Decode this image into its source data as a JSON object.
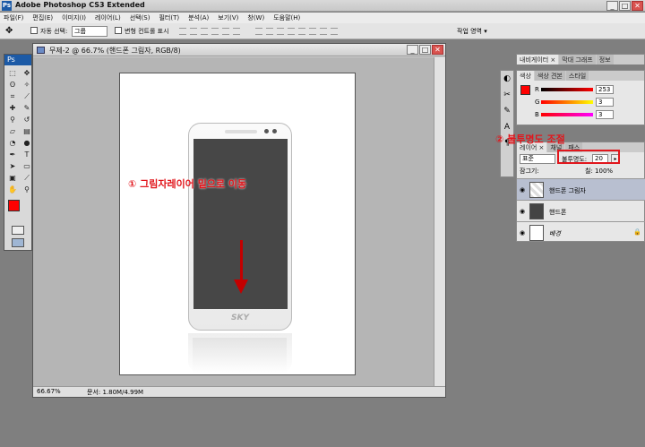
{
  "app": {
    "title": "Adobe Photoshop CS3 Extended",
    "icon_label": "Ps",
    "winbtns": [
      "_",
      "□",
      "✕"
    ]
  },
  "menu": [
    "파일(F)",
    "편집(E)",
    "이미지(I)",
    "레이어(L)",
    "선택(S)",
    "필터(T)",
    "분석(A)",
    "보기(V)",
    "창(W)",
    "도움말(H)"
  ],
  "options": {
    "auto_select_label": "자동 선택:",
    "auto_select_value": "그룹",
    "transform_label": "변형 컨트롤 표시",
    "workspace_label": "작업 영역 ▾"
  },
  "toolbox": {
    "logo": "Ps"
  },
  "document": {
    "title": "무제-2 @ 66.7% (핸드폰 그림자, RGB/8)",
    "zoom": "66.67%",
    "doc_info": "문서: 1.80M/4.99M",
    "phone_brand": "SKY"
  },
  "annotations": {
    "step1": "① 그림자레이어 밑으로 이동",
    "step2": "② 불투명도 조절"
  },
  "panels": {
    "nav_tabs": [
      "내비게이터 ×",
      "막대 그래프",
      "정보"
    ],
    "color_tabs": [
      "색상",
      "색상 견본",
      "스타일"
    ],
    "color": {
      "R": "253",
      "G": "3",
      "B": "3"
    },
    "layer_tabs": [
      "레이어 ×",
      "채널",
      "패스"
    ],
    "blend_mode": "표준",
    "opacity_label": "불투명도:",
    "opacity_value": "20",
    "lock_label": "잠그기:",
    "fill_label": "칠:",
    "fill_value": "100%",
    "layers": [
      {
        "name": "핸드폰 그림자",
        "selected": true
      },
      {
        "name": "핸드폰",
        "selected": false
      },
      {
        "name": "배경",
        "selected": false
      }
    ]
  },
  "colors": {
    "accent": "#e1161c",
    "foreground": "#ff0000",
    "background": "#ffffff"
  }
}
